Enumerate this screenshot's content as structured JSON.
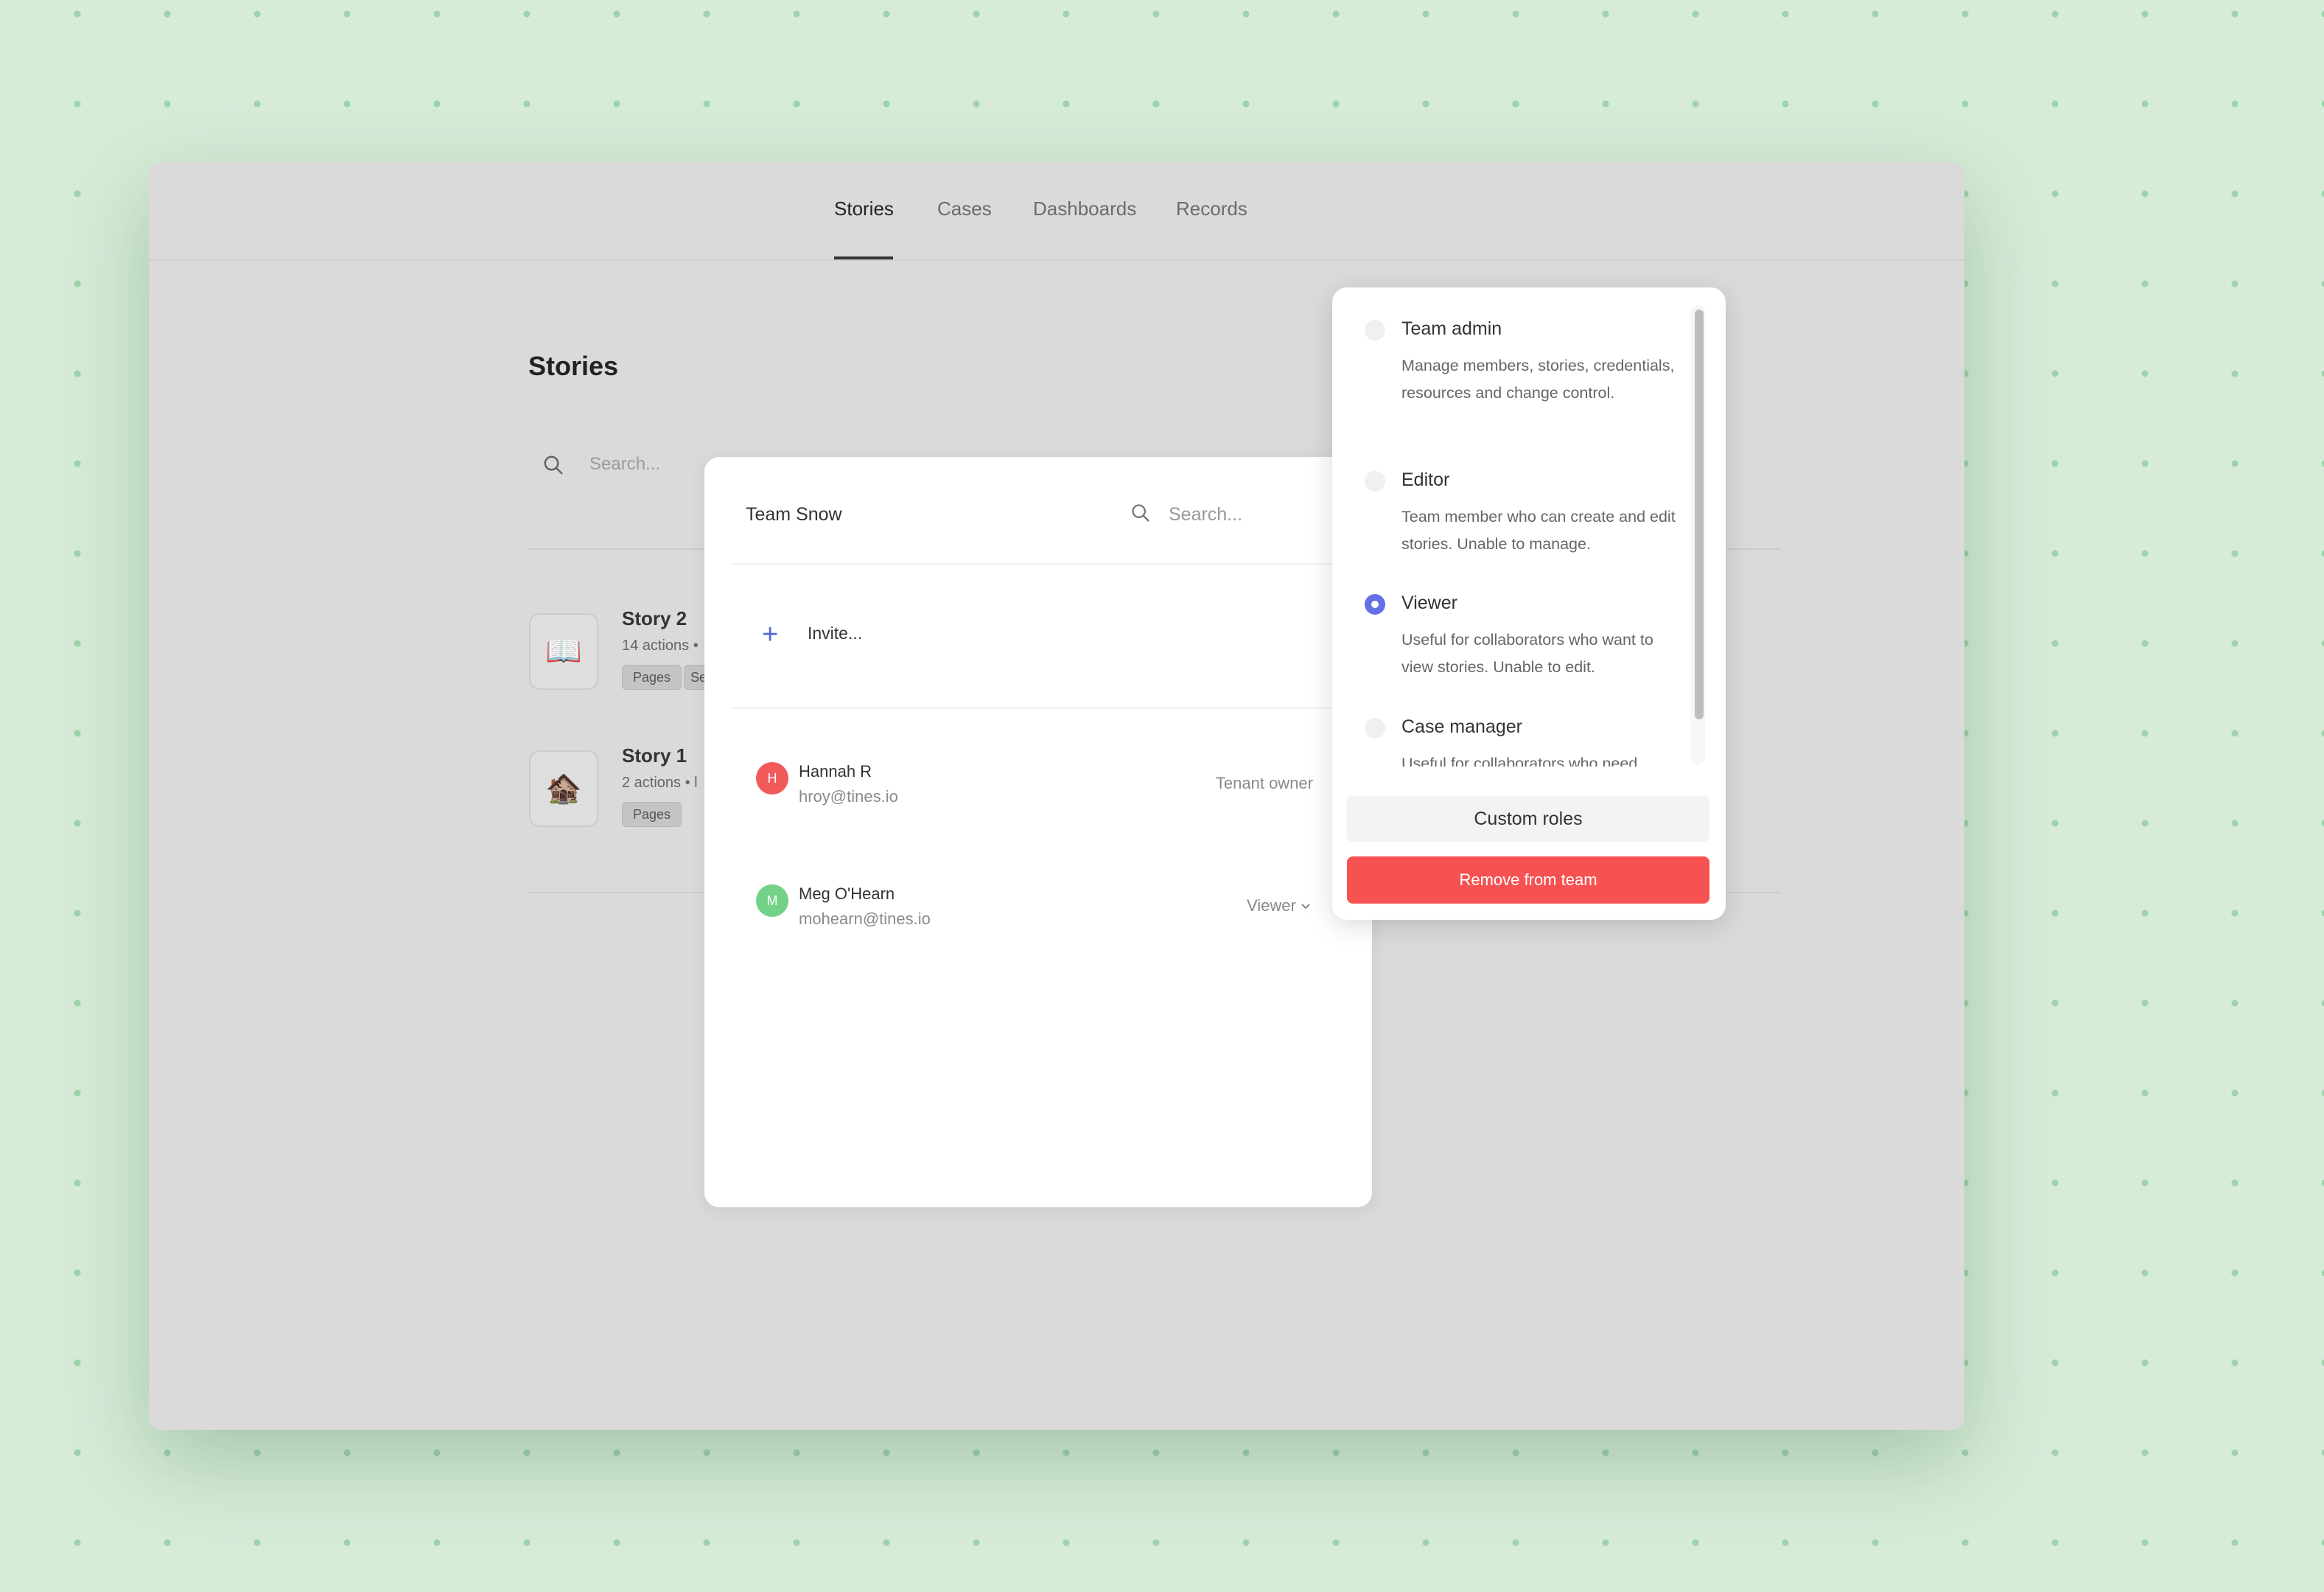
{
  "nav": {
    "tabs": [
      {
        "label": "Stories"
      },
      {
        "label": "Cases"
      },
      {
        "label": "Dashboards"
      },
      {
        "label": "Records"
      }
    ],
    "active": "Stories"
  },
  "page": {
    "title": "Stories",
    "search_placeholder": "Search..."
  },
  "stories": [
    {
      "name": "Story 2",
      "meta": "14 actions •",
      "tags": [
        "Pages",
        "Se"
      ],
      "emoji": "📖"
    },
    {
      "name": "Story 1",
      "meta": "2 actions • l",
      "tags": [
        "Pages"
      ],
      "emoji": "🏚️"
    }
  ],
  "team_modal": {
    "title": "Team Snow",
    "search_placeholder": "Search...",
    "invite_label": "Invite...",
    "members": [
      {
        "initial": "H",
        "name": "Hannah R",
        "email": "hroy@tines.io",
        "role": "Tenant owner",
        "avatar_color": "#f25a5a"
      },
      {
        "initial": "M",
        "name": "Meg O'Hearn",
        "email": "mohearn@tines.io",
        "role": "Viewer",
        "avatar_color": "#74d188"
      }
    ]
  },
  "role_dropdown": {
    "roles": [
      {
        "name": "Team admin",
        "description": "Manage members, stories, credentials, resources and change control.",
        "selected": false
      },
      {
        "name": "Editor",
        "description": "Team member who can create and edit stories. Unable to manage.",
        "selected": false
      },
      {
        "name": "Viewer",
        "description": "Useful for collaborators who want to view stories. Unable to edit.",
        "selected": true
      },
      {
        "name": "Case manager",
        "description": "Useful for collaborators who need",
        "selected": false
      }
    ],
    "custom_roles_label": "Custom roles",
    "remove_label": "Remove from team"
  },
  "colors": {
    "accent": "#6570e6",
    "danger": "#f65252",
    "background": "#d6ecd9"
  }
}
